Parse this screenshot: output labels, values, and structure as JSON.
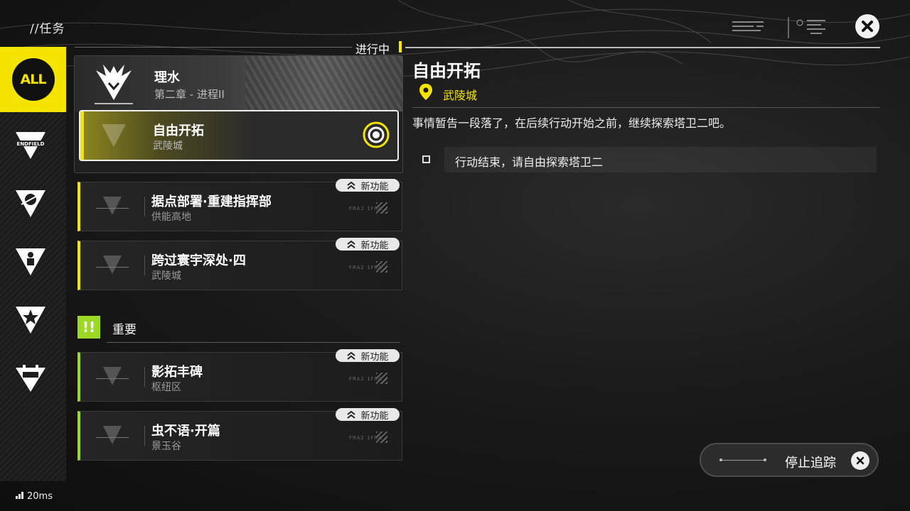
{
  "header": {
    "title": "//任务",
    "status": "进行中"
  },
  "sidebar": {
    "items": [
      {
        "label": "ALL",
        "icon": "all-badge-icon",
        "active": true
      },
      {
        "label": "ENDFIELD",
        "icon": "endfield-icon"
      },
      {
        "icon": "planet-icon"
      },
      {
        "icon": "person-icon"
      },
      {
        "icon": "star-icon"
      },
      {
        "icon": "robot-icon"
      }
    ]
  },
  "active_group": {
    "name": "理水",
    "chapter": "第二章 - 进程II"
  },
  "quests": [
    {
      "name": "自由开拓",
      "location": "武陵城",
      "tracked": true
    },
    {
      "name": "据点部署·重建指挥部",
      "location": "供能高地",
      "tag": "新功能",
      "code": "FRA2 1FRA"
    },
    {
      "name": "跨过寰宇深处·四",
      "location": "武陵城",
      "tag": "新功能",
      "code": "FRA2 1FRA"
    }
  ],
  "section": {
    "icon": "!!",
    "title": "重要"
  },
  "important_quests": [
    {
      "name": "影拓丰碑",
      "location": "枢纽区",
      "tag": "新功能",
      "code": "FRA2 1FRA"
    },
    {
      "name": "虫不语·开篇",
      "location": "景玉谷",
      "tag": "新功能",
      "code": "FRA2 1FRA"
    }
  ],
  "detail": {
    "title": "自由开拓",
    "location": "武陵城",
    "description": "事情暂告一段落了，在后续行动开始之前，继续探索塔卫二吧。",
    "objective": "行动结束，请自由探索塔卫二"
  },
  "stop_button": {
    "label": "停止追踪"
  },
  "ping": "20ms",
  "colors": {
    "accent_yellow": "#f4e400",
    "accent_green": "#9bd924"
  }
}
